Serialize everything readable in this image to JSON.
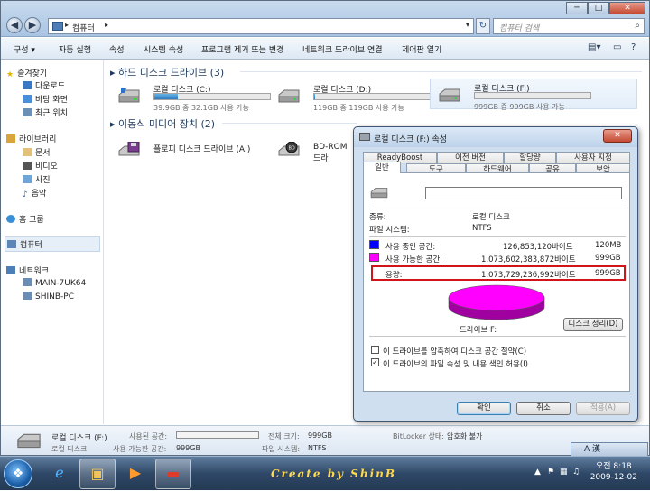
{
  "window": {
    "address": [
      "컴퓨터"
    ],
    "search_placeholder": "컴퓨터 검색",
    "buttons": {
      "minimize": "─",
      "maximize": "□",
      "close": "✕"
    }
  },
  "toolbar": [
    "구성 ▾",
    "자동 실행",
    "속성",
    "시스템 속성",
    "프로그램 제거 또는 변경",
    "네트워크 드라이브 연결",
    "제어판 열기"
  ],
  "sidebar": {
    "favorites": "즐겨찾기",
    "favorites_items": [
      "다운로드",
      "바탕 화면",
      "최근 위치"
    ],
    "libraries": "라이브러리",
    "library_items": [
      "문서",
      "비디오",
      "사진",
      "음악"
    ],
    "homegroup": "홈 그룹",
    "computer": "컴퓨터",
    "network": "네트워크",
    "network_items": [
      "MAIN-7UK64",
      "SHINB-PC"
    ]
  },
  "main": {
    "hdd_group": "하드 디스크 드라이브 (3)",
    "removable_group": "이동식 미디어 장치 (2)",
    "drives": [
      {
        "name": "로컬 디스크 (C:)",
        "info": "39.9GB 중 32.1GB 사용 가능",
        "used_fraction": 0.2
      },
      {
        "name": "로컬 디스크 (D:)",
        "info": "119GB 중 119GB 사용 가능",
        "used_fraction": 0.005
      },
      {
        "name": "로컬 디스크 (F:)",
        "info": "999GB 중 999GB 사용 가능",
        "used_fraction": 0.0
      }
    ],
    "removable": [
      {
        "name": "플로피 디스크 드라이브 (A:)"
      },
      {
        "name": "BD-ROM 드라"
      }
    ]
  },
  "details": {
    "name": "로컬 디스크 (F:)",
    "type": "로컬 디스크",
    "used_label": "사용된 공간:",
    "free_label": "사용 가능한 공간:",
    "free_value": "999GB",
    "total_label": "전체 크기:",
    "total_value": "999GB",
    "fs_label": "파일 시스템:",
    "fs_value": "NTFS",
    "bitlocker_label": "BitLocker 상태:",
    "bitlocker_value": "암호화 불가"
  },
  "dialog": {
    "title": "로컬 디스크 (F:) 속성",
    "close": "✕",
    "tabs_top": [
      "ReadyBoost",
      "이전 버전",
      "할당량",
      "사용자 지정"
    ],
    "tabs_bottom": [
      "일반",
      "도구",
      "하드웨어",
      "공유",
      "보안"
    ],
    "type_label": "종류:",
    "type_value": "로컬 디스크",
    "fs_label": "파일 시스템:",
    "fs_value": "NTFS",
    "used_label": "사용 중인 공간:",
    "used_bytes": "126,853,120바이트",
    "used_short": "120MB",
    "free_label": "사용 가능한 공간:",
    "free_bytes": "1,073,602,383,872바이트",
    "free_short": "999GB",
    "capacity_label": "용량:",
    "capacity_bytes": "1,073,729,236,992바이트",
    "capacity_short": "999GB",
    "drive_label": "드라이브 F:",
    "cleanup": "디스크 정리(D)",
    "compress": "이 드라이브를 압축하여 디스크 공간 절약(C)",
    "index": "이 드라이브의 파일 속성 및 내용 색인 허용(I)",
    "compress_checked": false,
    "index_checked": true,
    "ok": "확인",
    "cancel": "취소",
    "apply": "적용(A)",
    "used_color": "#0000ff",
    "free_color": "#ff00ff",
    "used_fraction": 0.0001
  },
  "taskbar": {
    "banner": "Create by ShinB",
    "time": "오전 8:18",
    "date": "2009-12-02",
    "lang": "A 漢"
  }
}
